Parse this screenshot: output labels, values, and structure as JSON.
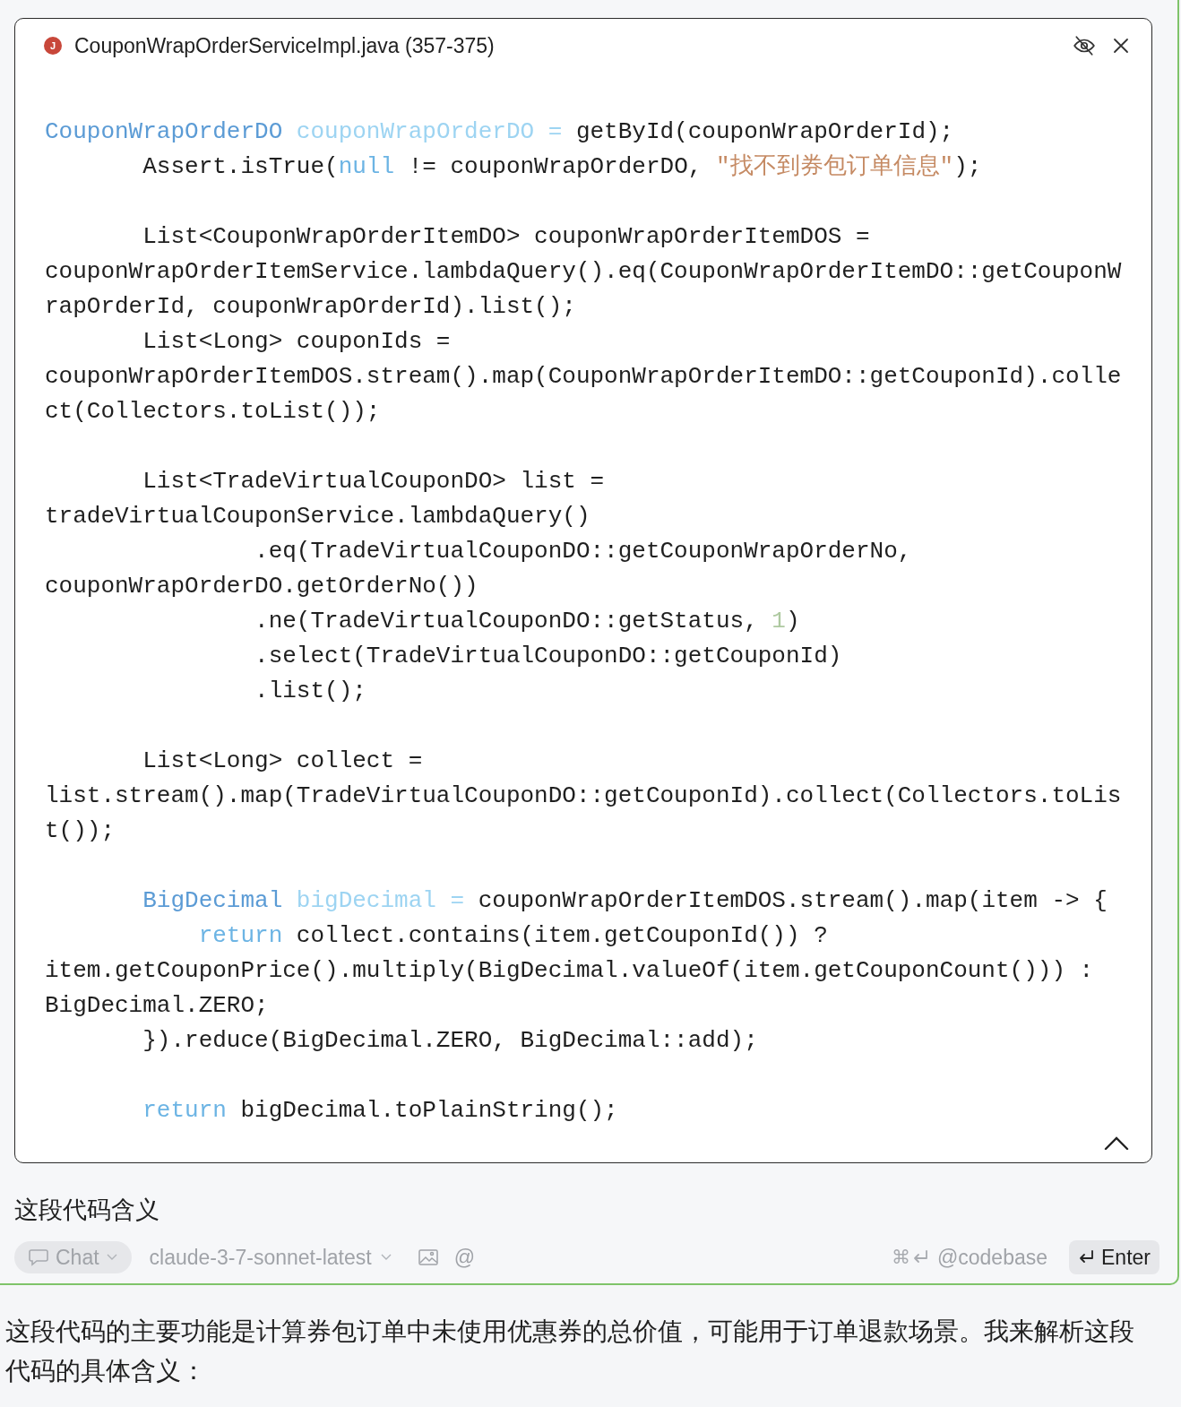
{
  "code_popup": {
    "file_badge": "J",
    "title": "CouponWrapOrderServiceImpl.java (357-375)",
    "blocks": [
      [
        [
          {
            "text": "CouponWrapOrderDO",
            "kind": "type"
          },
          {
            "text": " couponWrapOrderDO =",
            "kind": "var"
          },
          {
            "text": " getById(couponWrapOrderId);",
            "kind": "plain"
          }
        ],
        [
          {
            "text": "       Assert.isTrue(",
            "kind": "plain"
          },
          {
            "text": "null",
            "kind": "keyword"
          },
          {
            "text": " != couponWrapOrderDO, ",
            "kind": "plain"
          },
          {
            "text": "\"找不到券包订单信息\"",
            "kind": "string"
          },
          {
            "text": ");",
            "kind": "plain"
          }
        ]
      ],
      [
        [
          {
            "text": "       List<CouponWrapOrderItemDO> couponWrapOrderItemDOS =",
            "kind": "plain"
          }
        ],
        [
          {
            "text": "couponWrapOrderItemService.lambdaQuery().eq(CouponWrapOrderItemDO::getCouponW",
            "kind": "plain"
          }
        ],
        [
          {
            "text": "rapOrderId, couponWrapOrderId).list();",
            "kind": "plain"
          }
        ],
        [
          {
            "text": "       List<Long> couponIds =",
            "kind": "plain"
          }
        ],
        [
          {
            "text": "couponWrapOrderItemDOS.stream().map(CouponWrapOrderItemDO::getCouponId).colle",
            "kind": "plain"
          }
        ],
        [
          {
            "text": "ct(Collectors.toList());",
            "kind": "plain"
          }
        ]
      ],
      [
        [
          {
            "text": "       List<TradeVirtualCouponDO> list =",
            "kind": "plain"
          }
        ],
        [
          {
            "text": "tradeVirtualCouponService.lambdaQuery()",
            "kind": "plain"
          }
        ],
        [
          {
            "text": "               .eq(TradeVirtualCouponDO::getCouponWrapOrderNo,",
            "kind": "plain"
          }
        ],
        [
          {
            "text": "couponWrapOrderDO.getOrderNo())",
            "kind": "plain"
          }
        ],
        [
          {
            "text": "               .ne(TradeVirtualCouponDO::getStatus, ",
            "kind": "plain"
          },
          {
            "text": "1",
            "kind": "number"
          },
          {
            "text": ")",
            "kind": "plain"
          }
        ],
        [
          {
            "text": "               .select(TradeVirtualCouponDO::getCouponId)",
            "kind": "plain"
          }
        ],
        [
          {
            "text": "               .list();",
            "kind": "plain"
          }
        ]
      ],
      [
        [
          {
            "text": "       List<Long> collect =",
            "kind": "plain"
          }
        ],
        [
          {
            "text": "list.stream().map(TradeVirtualCouponDO::getCouponId).collect(Collectors.toLis",
            "kind": "plain"
          }
        ],
        [
          {
            "text": "t());",
            "kind": "plain"
          }
        ]
      ],
      [
        [
          {
            "text": "       BigDecimal",
            "kind": "type"
          },
          {
            "text": " bigDecimal =",
            "kind": "var"
          },
          {
            "text": " couponWrapOrderItemDOS.stream().map(item -> {",
            "kind": "plain"
          }
        ],
        [
          {
            "text": "           return",
            "kind": "keyword"
          },
          {
            "text": " collect.contains(item.getCouponId()) ?",
            "kind": "plain"
          }
        ],
        [
          {
            "text": "item.getCouponPrice().multiply(BigDecimal.valueOf(item.getCouponCount())) :",
            "kind": "plain"
          }
        ],
        [
          {
            "text": "BigDecimal.ZERO;",
            "kind": "plain"
          }
        ],
        [
          {
            "text": "       }).reduce(BigDecimal.ZERO, BigDecimal::add);",
            "kind": "plain"
          }
        ]
      ],
      [
        [
          {
            "text": "       return",
            "kind": "keyword"
          },
          {
            "text": " bigDecimal.toPlainString();",
            "kind": "plain"
          }
        ]
      ]
    ]
  },
  "prompt": "这段代码含义",
  "toolbar": {
    "mode": "Chat",
    "model": "claude-3-7-sonnet-latest",
    "mention": "@",
    "shortcut_key": "⌘",
    "codebase": "@codebase",
    "submit": "Enter"
  },
  "answer": "这段代码的主要功能是计算券包订单中未使用优惠券的总价值，可能用于订单退款场景。我来解析这段代码的具体含义："
}
